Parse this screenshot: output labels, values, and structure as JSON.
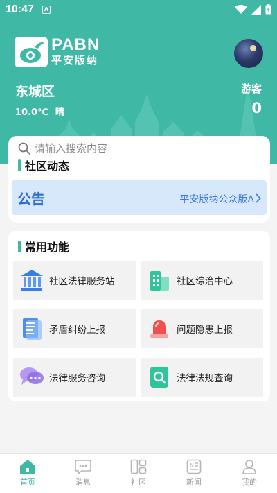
{
  "status": {
    "time": "10:47",
    "notification_badge": "A"
  },
  "brand": {
    "name_en": "PABN",
    "name_cn": "平安版纳"
  },
  "location": {
    "district": "东城区",
    "temperature": "10.0℃",
    "condition": "晴"
  },
  "user": {
    "role_label": "游客",
    "count": "0"
  },
  "search": {
    "placeholder": "请输入搜索内容"
  },
  "community": {
    "title": "社区动态",
    "notice": {
      "label": "公告",
      "text": "平安版纳公众版A"
    }
  },
  "functions": {
    "title": "常用功能",
    "items": [
      {
        "label": "社区法律服务站",
        "icon": "courthouse-icon"
      },
      {
        "label": "社区综治中心",
        "icon": "building-icon"
      },
      {
        "label": "矛盾纠纷上报",
        "icon": "report-form-icon"
      },
      {
        "label": "问题隐患上报",
        "icon": "alarm-siren-icon"
      },
      {
        "label": "法律服务咨询",
        "icon": "chat-bubbles-icon"
      },
      {
        "label": "法律法规查询",
        "icon": "search-document-icon"
      }
    ]
  },
  "nav": {
    "items": [
      {
        "label": "首页",
        "icon": "home-icon",
        "active": true
      },
      {
        "label": "消息",
        "icon": "message-icon",
        "active": false
      },
      {
        "label": "社区",
        "icon": "community-icon",
        "active": false
      },
      {
        "label": "新闻",
        "icon": "news-icon",
        "active": false
      },
      {
        "label": "我的",
        "icon": "profile-icon",
        "active": false
      }
    ]
  },
  "colors": {
    "primary": "#3fb8a6",
    "notice_bg": "#d8e8fb",
    "notice_text": "#2d6cd9"
  }
}
